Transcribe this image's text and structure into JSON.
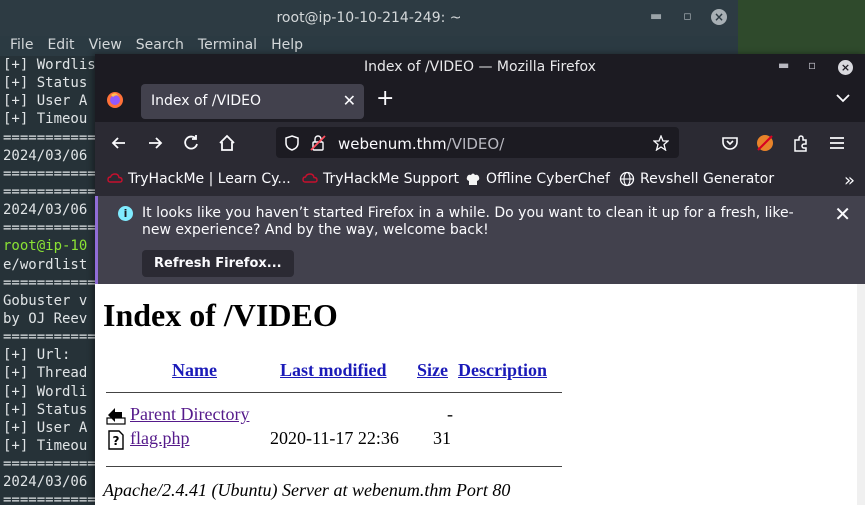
{
  "terminal": {
    "title": "root@ip-10-10-214-249: ~",
    "menu": [
      "File",
      "Edit",
      "View",
      "Search",
      "Terminal",
      "Help"
    ],
    "lines": [
      "[+] Wordlis",
      "[+] Status",
      "[+] User A",
      "[+] Timeou",
      "===========",
      "2024/03/06",
      "===========",
      "===========",
      "2024/03/06",
      "===========",
      "root@ip-10",
      "e/wordlist",
      "===========",
      "Gobuster v",
      "by OJ Reev",
      "===========",
      "[+] Url:",
      "[+] Thread",
      "[+] Wordli",
      "[+] Status",
      "[+] User A",
      "[+] Timeou",
      "===========",
      "2024/03/06",
      "==========="
    ]
  },
  "firefox": {
    "window_title": "Index of /VIDEO — Mozilla Firefox",
    "tab_label": "Index of /VIDEO",
    "url_host": "webenum.thm",
    "url_path": "/VIDEO/",
    "bookmarks": [
      "TryHackMe | Learn Cy...",
      "TryHackMe Support",
      "Offline CyberChef",
      "Revshell Generator"
    ],
    "notice_text": "It looks like you haven’t started Firefox in a while. Do you want to clean it up for a fresh, like-new experience? And by the way, welcome back!",
    "notice_button": "Refresh Firefox..."
  },
  "listing": {
    "title": "Index of /VIDEO",
    "columns": {
      "name": "Name",
      "modified": "Last modified",
      "size": "Size",
      "description": "Description"
    },
    "parent": {
      "name": "Parent Directory",
      "size": "-"
    },
    "files": [
      {
        "name": "flag.php",
        "modified": "2020-11-17 22:36",
        "size": "31"
      }
    ],
    "address": "Apache/2.4.41 (Ubuntu) Server at webenum.thm Port 80"
  },
  "colors": {
    "terminal_bg": "#263238",
    "firefox_chrome": "#2b2a33",
    "link": "#1a1ab8",
    "visited_link": "#551a8b",
    "notice_accent": "#8f6cd6"
  }
}
